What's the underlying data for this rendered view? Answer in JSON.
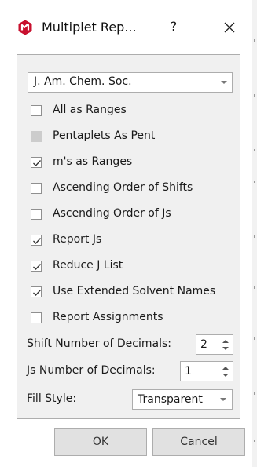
{
  "window": {
    "title": "Multiplet Rep...",
    "help_label": "?",
    "app_icon": "mnova-logo-icon",
    "close_icon": "close-icon",
    "accent_color": "#c8102e"
  },
  "format": {
    "selected": "J. Am. Chem. Soc."
  },
  "options": [
    {
      "label": "All as Ranges",
      "checked": false,
      "enabled": true
    },
    {
      "label": "Pentaplets As Pent",
      "checked": false,
      "enabled": false
    },
    {
      "label": "m's as Ranges",
      "checked": true,
      "enabled": true
    },
    {
      "label": "Ascending Order of Shifts",
      "checked": false,
      "enabled": true
    },
    {
      "label": "Ascending Order of Js",
      "checked": false,
      "enabled": true
    },
    {
      "label": "Report Js",
      "checked": true,
      "enabled": true
    },
    {
      "label": "Reduce J List",
      "checked": true,
      "enabled": true
    },
    {
      "label": "Use Extended Solvent Names",
      "checked": true,
      "enabled": true
    },
    {
      "label": "Report Assignments",
      "checked": false,
      "enabled": true
    }
  ],
  "shift_decimals": {
    "label": "Shift Number of Decimals:",
    "value": "2"
  },
  "js_decimals": {
    "label": "Js Number of Decimals:",
    "value": "1"
  },
  "fill_style": {
    "label": "Fill Style:",
    "value": "Transparent"
  },
  "buttons": {
    "ok": "OK",
    "cancel": "Cancel"
  }
}
